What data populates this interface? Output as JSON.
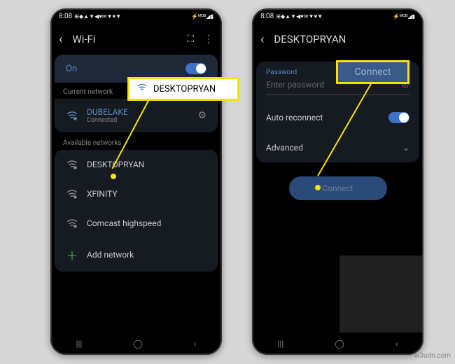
{
  "status": {
    "time": "8:08",
    "icons_left": "⊞◆▲▼◀♥✉▼♥▼",
    "icons_right": "⚡ᴹᴼᴮ◢▮"
  },
  "left": {
    "header": "Wi-Fi",
    "toggle_label": "On",
    "current_label": "Current network",
    "current": {
      "name": "DUBELAKE",
      "status": "Connected"
    },
    "available_label": "Available networks",
    "networks": [
      "DESKTOPRYAN",
      "XFINITY",
      "Comcast highspeed"
    ],
    "add": "Add network",
    "callout": "DESKTOPRYAN"
  },
  "right": {
    "header": "DESKTOPRYAN",
    "password_label": "Password",
    "password_placeholder": "Enter password",
    "auto": "Auto reconnect",
    "advanced": "Advanced",
    "connect": "Connect",
    "callout": "Connect"
  },
  "watermark": "w3udn.com"
}
